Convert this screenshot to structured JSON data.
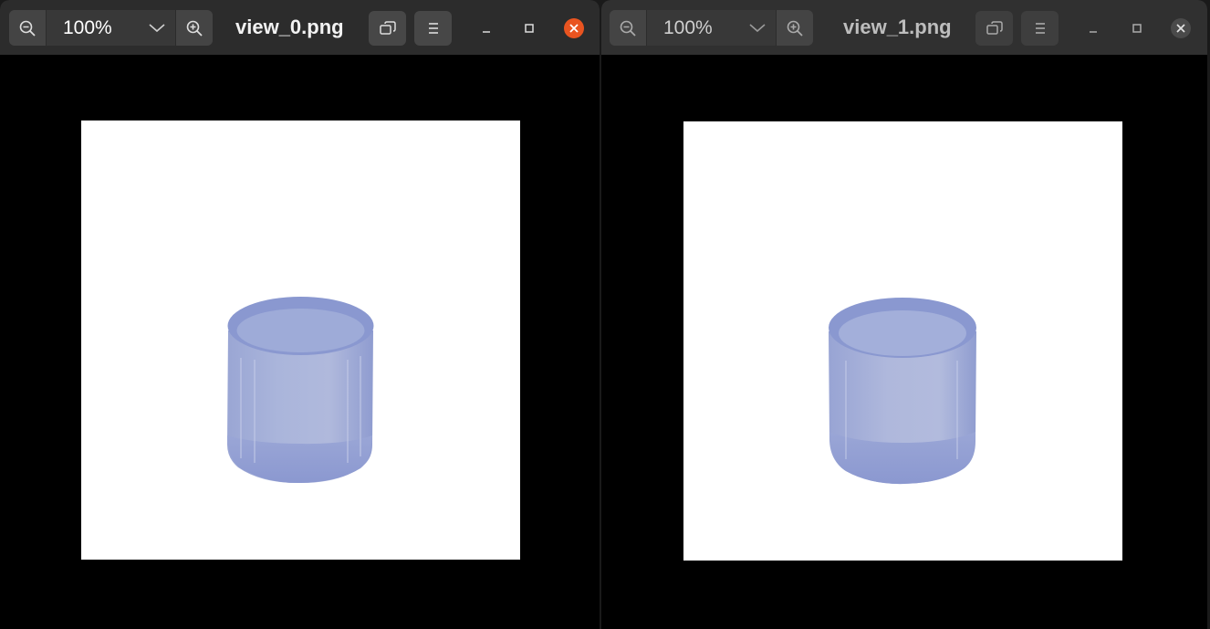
{
  "windows": [
    {
      "title": "view_0.png",
      "zoom": "100%",
      "active": true,
      "close_color": "#e95420"
    },
    {
      "title": "view_1.png",
      "zoom": "100%",
      "active": false,
      "close_color": "#4a4a4a"
    }
  ],
  "icons": {
    "zoom_out": "zoom-out-icon",
    "zoom_dropdown": "chevron-down-icon",
    "zoom_in": "zoom-in-icon",
    "view_toggle": "rotate-view-icon",
    "menu": "hamburger-menu-icon",
    "minimize": "minimize-icon",
    "maximize": "maximize-icon",
    "close": "close-icon"
  },
  "image_content": {
    "background": "#ffffff",
    "object_color": "#8c9bd0",
    "object": "cylinder"
  }
}
